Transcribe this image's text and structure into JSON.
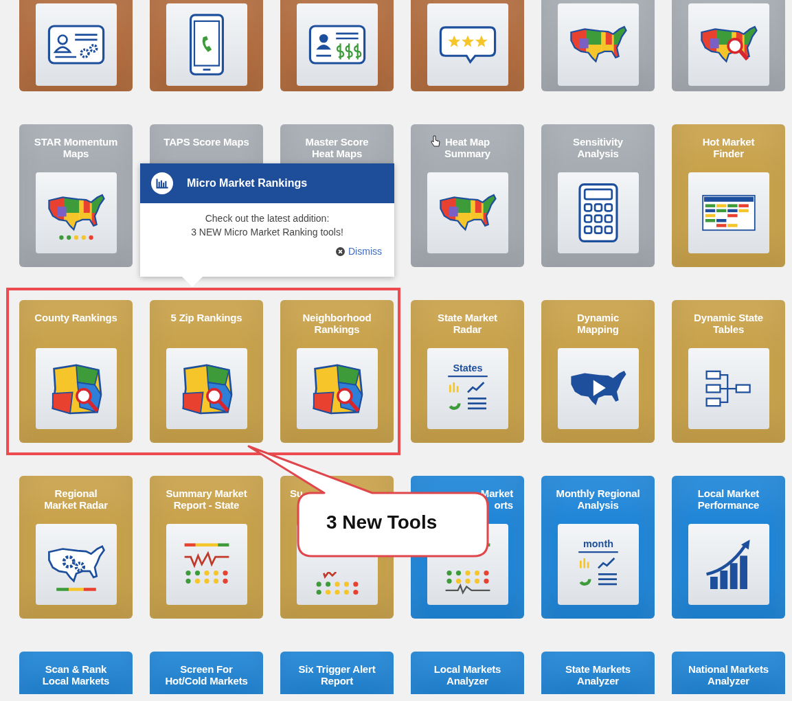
{
  "rows": [
    {
      "tiles": [
        {
          "kind": "cropped-top",
          "color": "#b36d3e"
        },
        {
          "kind": "cropped-top",
          "color": "#b36d3e"
        },
        {
          "kind": "cropped-top",
          "color": "#b36d3e"
        },
        {
          "kind": "cropped-top",
          "color": "#b36d3e"
        },
        {
          "kind": "cropped-top",
          "color": "#a6acb2"
        },
        {
          "kind": "cropped-top",
          "color": "#a6acb2"
        }
      ]
    },
    {
      "tiles": [
        {
          "kind": "full",
          "title": "STAR Momentum\nMaps",
          "color": "#a6acb2"
        },
        {
          "kind": "full",
          "title": "TAPS Score Maps",
          "color": "#a6acb2"
        },
        {
          "kind": "full",
          "title": "Master Score\nHeat Maps",
          "color": "#a6acb2"
        },
        {
          "kind": "full",
          "title": "Heat Map\nSummary",
          "color": "#a6acb2"
        },
        {
          "kind": "full",
          "title": "Sensitivity\nAnalysis",
          "color": "#a6acb2"
        },
        {
          "kind": "full",
          "title": "Hot Market\nFinder",
          "color": "#c9a24b"
        }
      ]
    },
    {
      "tiles": [
        {
          "kind": "full",
          "title": "County Rankings",
          "color": "#c9a24b"
        },
        {
          "kind": "full",
          "title": "5 Zip Rankings",
          "color": "#c9a24b"
        },
        {
          "kind": "full",
          "title": "Neighborhood\nRankings",
          "color": "#c9a24b"
        },
        {
          "kind": "full",
          "title": "State Market\nRadar",
          "color": "#c9a24b",
          "icon_caption": "States"
        },
        {
          "kind": "full",
          "title": "Dynamic\nMapping",
          "color": "#c9a24b"
        },
        {
          "kind": "full",
          "title": "Dynamic State\nTables",
          "color": "#c9a24b"
        }
      ]
    },
    {
      "tiles": [
        {
          "kind": "full",
          "title": "Regional\nMarket Radar",
          "color": "#c9a24b"
        },
        {
          "kind": "full",
          "title": "Summary Market\nReport - State",
          "color": "#c9a24b"
        },
        {
          "kind": "partial-start",
          "title": "Su",
          "color": "#c9a24b"
        },
        {
          "kind": "partial-end",
          "title": "Market\norts",
          "color": "#2086d8"
        },
        {
          "kind": "full",
          "title": "Monthly Regional\nAnalysis",
          "color": "#2086d8",
          "icon_caption": "month"
        },
        {
          "kind": "full",
          "title": "Local Market\nPerformance",
          "color": "#2086d8"
        }
      ]
    },
    {
      "tiles": [
        {
          "kind": "cropped-bottom",
          "title": "Scan & Rank\nLocal Markets",
          "color": "#2086d8"
        },
        {
          "kind": "cropped-bottom",
          "title": "Screen For\nHot/Cold Markets",
          "color": "#2086d8"
        },
        {
          "kind": "cropped-bottom",
          "title": "Six Trigger Alert\nReport",
          "color": "#2086d8"
        },
        {
          "kind": "cropped-bottom",
          "title": "Local Markets\nAnalyzer",
          "color": "#2086d8"
        },
        {
          "kind": "cropped-bottom",
          "title": "State Markets\nAnalyzer",
          "color": "#2086d8"
        },
        {
          "kind": "cropped-bottom",
          "title": "National Markets\nAnalyzer",
          "color": "#2086d8"
        }
      ]
    }
  ],
  "popup": {
    "title": "Micro Market Rankings",
    "message": "Check out the latest addition:\n3 NEW Micro Market Ranking tools!",
    "dismiss": "Dismiss"
  },
  "callout": {
    "text": "3 New Tools"
  }
}
